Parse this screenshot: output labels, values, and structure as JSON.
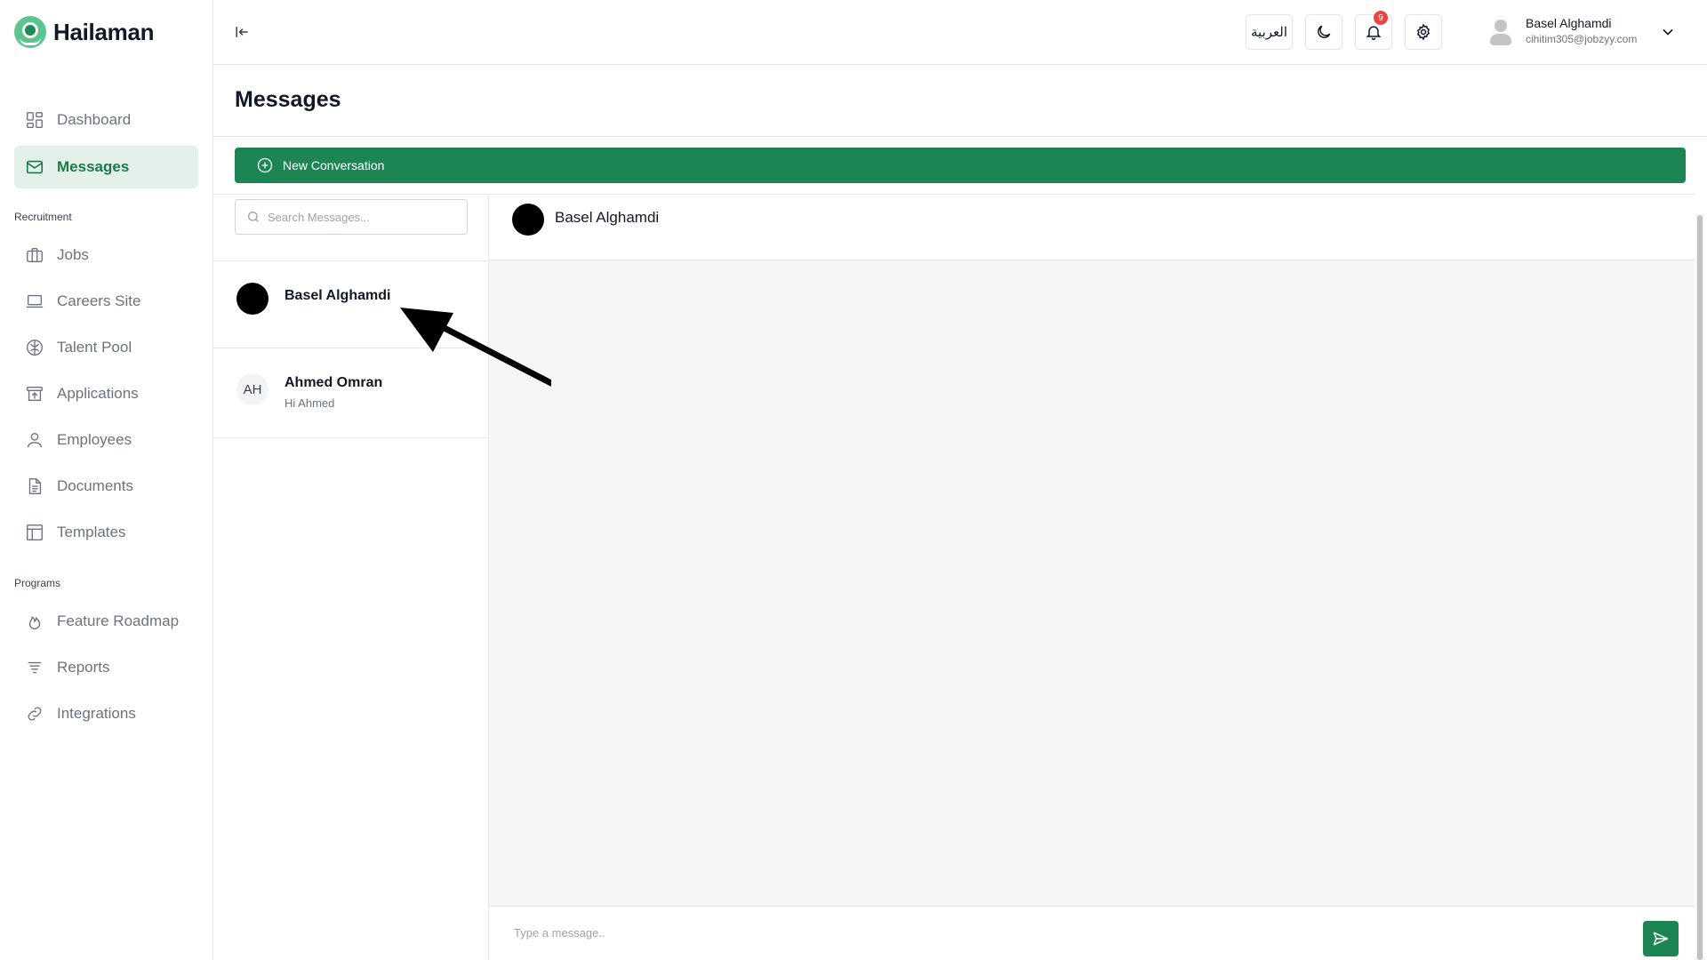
{
  "app": {
    "brand": "Hailaman",
    "brand_color": "#1d8454"
  },
  "sidebar": {
    "items_top": [
      {
        "label": "Dashboard",
        "icon": "dashboard-icon"
      },
      {
        "label": "Messages",
        "icon": "mail-icon",
        "active": true
      }
    ],
    "section_recruitment": "Recruitment",
    "items_recruitment": [
      {
        "label": "Jobs",
        "icon": "briefcase-icon"
      },
      {
        "label": "Careers Site",
        "icon": "laptop-icon"
      },
      {
        "label": "Talent Pool",
        "icon": "brain-icon"
      },
      {
        "label": "Applications",
        "icon": "archive-icon"
      },
      {
        "label": "Employees",
        "icon": "user-icon"
      },
      {
        "label": "Documents",
        "icon": "document-icon"
      },
      {
        "label": "Templates",
        "icon": "layout-icon"
      }
    ],
    "section_programs": "Programs",
    "items_programs": [
      {
        "label": "Feature Roadmap",
        "icon": "flame-icon"
      },
      {
        "label": "Reports",
        "icon": "filter-list-icon"
      },
      {
        "label": "Integrations",
        "icon": "link-icon"
      }
    ]
  },
  "header": {
    "language_label": "العربية",
    "notification_count": "9",
    "user_name": "Basel Alghamdi",
    "user_email": "cihitim305@jobzyy.com"
  },
  "page": {
    "title": "Messages",
    "new_conversation_label": "New Conversation"
  },
  "conversations": {
    "search_placeholder": "Search Messages...",
    "items": [
      {
        "name": "Basel Alghamdi",
        "preview": "",
        "avatar": "black"
      },
      {
        "name": "Ahmed Omran",
        "preview": "Hi Ahmed",
        "initials": "AH"
      }
    ]
  },
  "chat": {
    "contact_name": "Basel Alghamdi",
    "input_placeholder": "Type a message.."
  }
}
